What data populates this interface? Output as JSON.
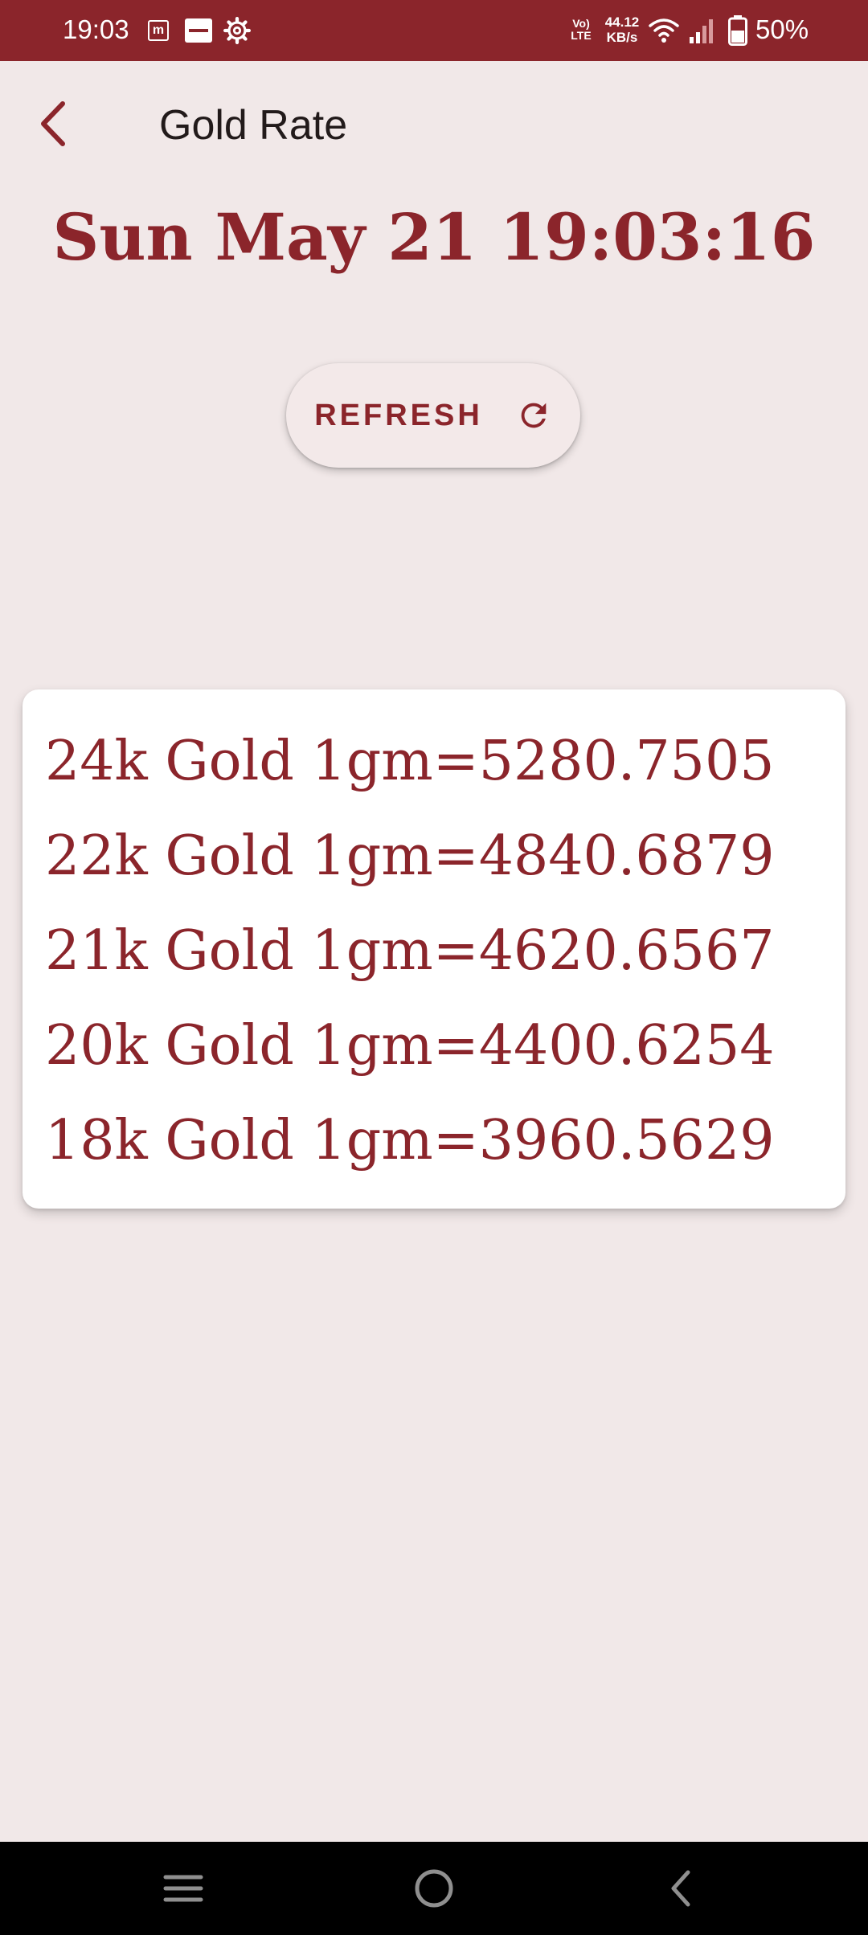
{
  "status_bar": {
    "time": "19:03",
    "volte_line1": "Vo)",
    "volte_line2": "LTE",
    "speed_line1": "44.12",
    "speed_line2": "KB/s",
    "battery": "50%",
    "icons": [
      "m-app-icon",
      "zomato-icon",
      "gear-icon",
      "volte-icon",
      "wifi-icon",
      "signal-icon",
      "battery-icon"
    ]
  },
  "app_bar": {
    "title": "Gold Rate",
    "back_icon": "chevron-left-icon"
  },
  "datetime": "Sun May 21 19:03:16",
  "refresh": {
    "label": "REFRESH",
    "icon": "refresh-icon"
  },
  "rates": [
    {
      "text": "24k Gold 1gm=5280.7505"
    },
    {
      "text": "22k Gold 1gm=4840.6879"
    },
    {
      "text": "21k Gold 1gm=4620.6567"
    },
    {
      "text": "20k Gold 1gm=4400.6254"
    },
    {
      "text": "18k Gold 1gm=3960.5629"
    }
  ],
  "colors": {
    "brand": "#8b252b",
    "background": "#f1e8e8",
    "card": "#ffffff",
    "nav_bar": "#000000"
  },
  "nav_bar": {
    "icons": [
      "menu-icon",
      "home-icon",
      "back-icon"
    ]
  }
}
